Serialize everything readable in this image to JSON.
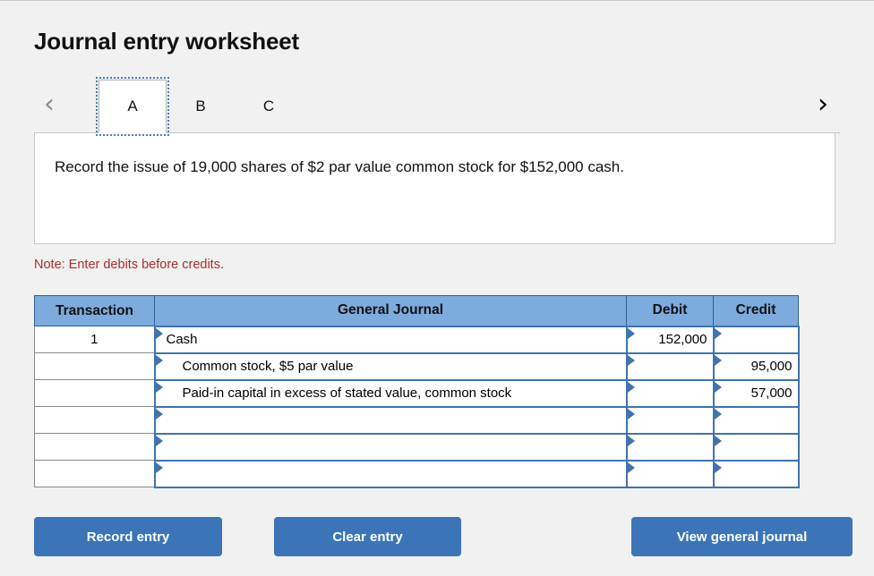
{
  "page_title": "Journal entry worksheet",
  "nav": {
    "prev_icon": "chevron-left-icon",
    "next_icon": "chevron-right-icon",
    "prev_label": "‹",
    "next_label": "›"
  },
  "tabs": [
    {
      "label": "A",
      "active": true
    },
    {
      "label": "B",
      "active": false
    },
    {
      "label": "C",
      "active": false
    }
  ],
  "description": "Record the issue of 19,000 shares of $2 par value common stock for $152,000 cash.",
  "note": "Note: Enter debits before credits.",
  "table": {
    "headers": [
      "Transaction",
      "General Journal",
      "Debit",
      "Credit"
    ],
    "rows": [
      {
        "transaction": "1",
        "account": "Cash",
        "indent": false,
        "debit": "152,000",
        "credit": ""
      },
      {
        "transaction": "",
        "account": "Common stock, $5 par value",
        "indent": true,
        "debit": "",
        "credit": "95,000"
      },
      {
        "transaction": "",
        "account": "Paid-in capital in excess of stated value, common stock",
        "indent": true,
        "debit": "",
        "credit": "57,000"
      },
      {
        "transaction": "",
        "account": "",
        "indent": false,
        "debit": "",
        "credit": ""
      },
      {
        "transaction": "",
        "account": "",
        "indent": false,
        "debit": "",
        "credit": ""
      },
      {
        "transaction": "",
        "account": "",
        "indent": false,
        "debit": "",
        "credit": ""
      }
    ]
  },
  "buttons": {
    "record": "Record entry",
    "clear": "Clear entry",
    "view": "View general journal"
  },
  "colors": {
    "header_blue": "#7dabdd",
    "cell_border_blue": "#3f74ae",
    "button_blue": "#3b75b8",
    "note_red": "#a8302c",
    "page_background": "#f1f1f1"
  }
}
